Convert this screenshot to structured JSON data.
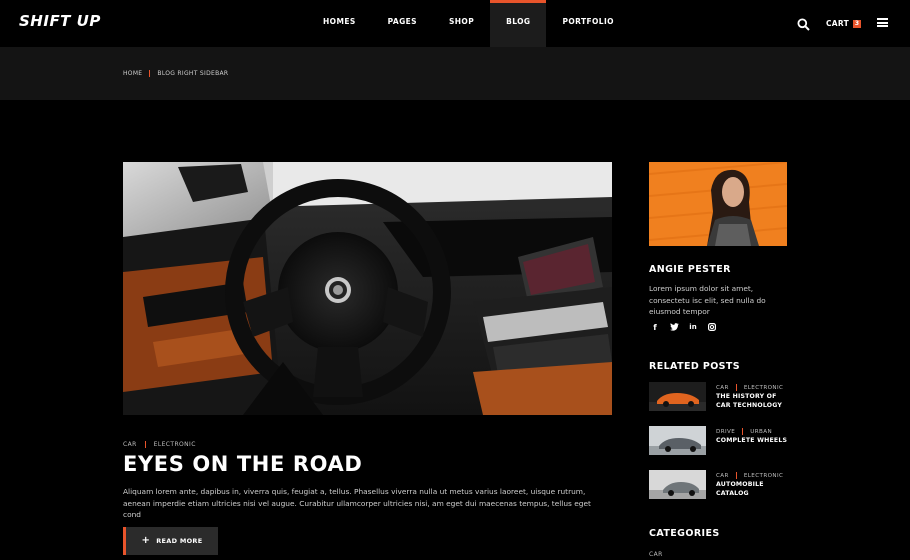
{
  "header": {
    "logo": "SHIFT UP",
    "nav": [
      "HOMES",
      "PAGES",
      "SHOP",
      "BLOG",
      "PORTFOLIO"
    ],
    "active_nav": "BLOG",
    "cart_label": "CART",
    "cart_count": "3"
  },
  "breadcrumb": {
    "home": "HOME",
    "current": "BLOG RIGHT SIDEBAR"
  },
  "post": {
    "categories": [
      "CAR",
      "ELECTRONIC"
    ],
    "title": "EYES ON THE ROAD",
    "excerpt": "Aliquam lorem ante, dapibus in, viverra quis, feugiat a, tellus. Phasellus viverra nulla ut metus varius laoreet, uisque rutrum, aenean imperdie etiam ultricies nisi vel augue. Curabitur ullamcorper ultricies nisi, am eget dui maecenas tempus, tellus eget cond",
    "read_more": "READ MORE",
    "read_more_icon": "plus-icon"
  },
  "sidebar": {
    "author": {
      "name": "ANGIE PESTER",
      "bio": "Lorem ipsum dolor sit amet, consectetu isc elit, sed nulla do eiusmod tempor",
      "socials": [
        {
          "icon": "facebook-icon",
          "glyph": "f"
        },
        {
          "icon": "twitter-icon",
          "glyph": "𝕥"
        },
        {
          "icon": "linkedin-icon",
          "glyph": "in"
        },
        {
          "icon": "instagram-icon",
          "glyph": "◎"
        }
      ]
    },
    "related_title": "RELATED POSTS",
    "related": [
      {
        "cat1": "CAR",
        "cat2": "ELECTRONIC",
        "title": "THE HISTORY OF CAR TECHNOLOGY"
      },
      {
        "cat1": "DRIVE",
        "cat2": "URBAN",
        "title": "COMPLETE WHEELS"
      },
      {
        "cat1": "CAR",
        "cat2": "ELECTRONIC",
        "title": "AUTOMOBILE CATALOG"
      }
    ],
    "categories_title": "CATEGORIES",
    "categories": [
      "CAR"
    ]
  },
  "colors": {
    "accent": "#e8542b",
    "background": "#000000",
    "breadcrumb_bar": "#141414"
  }
}
